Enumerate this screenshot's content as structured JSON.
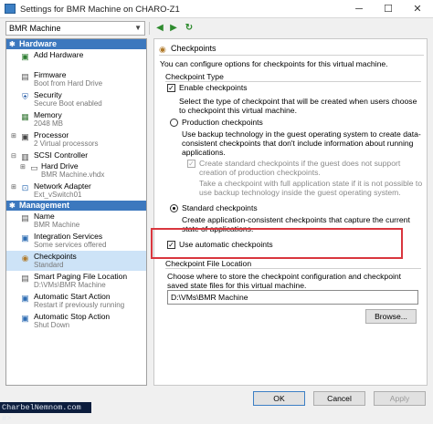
{
  "window": {
    "title": "Settings for BMR Machine on CHARO-Z1",
    "controls": {
      "minimize": "─",
      "maximize": "☐",
      "close": "✕"
    }
  },
  "toolbar": {
    "machine": "BMR Machine",
    "back": "◀",
    "forward": "▶",
    "refresh": "↻"
  },
  "tree": {
    "hardware_header": "Hardware",
    "management_header": "Management",
    "hardware": [
      {
        "label": "Add Hardware",
        "sub": "",
        "icon": "add-hardware-icon"
      },
      {
        "label": "Firmware",
        "sub": "Boot from Hard Drive",
        "icon": "firmware-icon"
      },
      {
        "label": "Security",
        "sub": "Secure Boot enabled",
        "icon": "shield-icon"
      },
      {
        "label": "Memory",
        "sub": "2048 MB",
        "icon": "memory-icon"
      },
      {
        "label": "Processor",
        "sub": "2 Virtual processors",
        "icon": "processor-icon"
      },
      {
        "label": "SCSI Controller",
        "sub": "",
        "icon": "scsi-icon"
      },
      {
        "label": "Hard Drive",
        "sub": "BMR Machine.vhdx",
        "icon": "hard-drive-icon"
      },
      {
        "label": "Network Adapter",
        "sub": "Ext_vSwitch01",
        "icon": "network-icon"
      }
    ],
    "management": [
      {
        "label": "Name",
        "sub": "BMR Machine",
        "icon": "name-icon"
      },
      {
        "label": "Integration Services",
        "sub": "Some services offered",
        "icon": "integration-icon"
      },
      {
        "label": "Checkpoints",
        "sub": "Standard",
        "icon": "checkpoint-icon"
      },
      {
        "label": "Smart Paging File Location",
        "sub": "D:\\VMs\\BMR Machine",
        "icon": "folder-icon"
      },
      {
        "label": "Automatic Start Action",
        "sub": "Restart if previously running",
        "icon": "start-action-icon"
      },
      {
        "label": "Automatic Stop Action",
        "sub": "Shut Down",
        "icon": "stop-action-icon"
      }
    ]
  },
  "panel": {
    "heading": "Checkpoints",
    "intro": "You can configure options for checkpoints for this virtual machine.",
    "type_group": "Checkpoint Type",
    "enable_label": "Enable checkpoints",
    "select_desc": "Select the type of checkpoint that will be created when users choose to checkpoint this virtual machine.",
    "production_label": "Production checkpoints",
    "production_desc": "Use backup technology in the guest operating system to create data-consistent checkpoints that don't include information about running applications.",
    "create_standard_label": "Create standard checkpoints if the guest does not support creation of production checkpoints.",
    "create_standard_desc": "Take a checkpoint with full application state if it is not possible to use backup technology inside the guest operating system.",
    "standard_label": "Standard checkpoints",
    "standard_desc": "Create application-consistent checkpoints that capture the current state of applications.",
    "auto_label": "Use automatic checkpoints",
    "location_group": "Checkpoint File Location",
    "location_desc": "Choose where to store the checkpoint configuration and checkpoint saved state files for this virtual machine.",
    "location_value": "D:\\VMs\\BMR Machine",
    "browse": "Browse..."
  },
  "buttons": {
    "ok": "OK",
    "cancel": "Cancel",
    "apply": "Apply"
  },
  "console_text": "CharbelNemnom.com #>",
  "colors": {
    "accent": "#3c78be",
    "highlight": "#d9363e",
    "selected": "#cde3f7"
  }
}
